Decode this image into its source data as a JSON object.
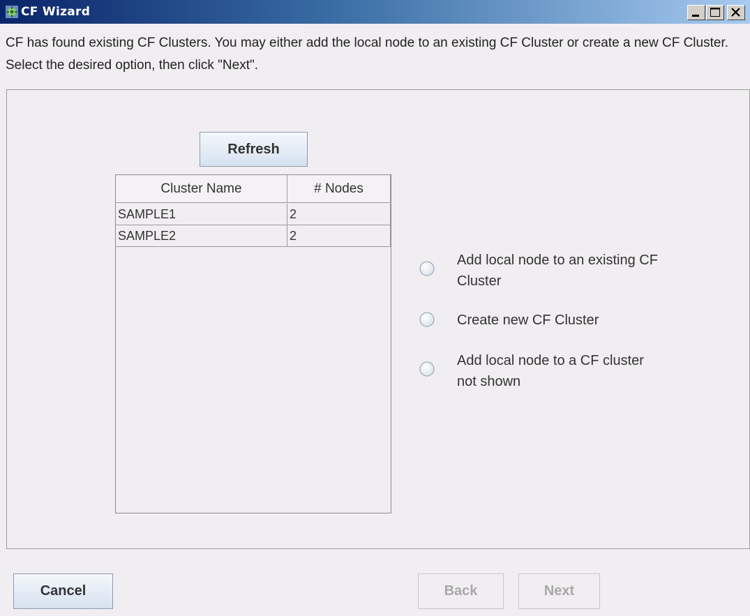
{
  "window": {
    "title": "CF Wizard",
    "icon": "cf-wizard-app-icon",
    "controls": [
      "minimize",
      "maximize",
      "close"
    ]
  },
  "instructions": "CF has found existing CF Clusters. You may either add the local node to an existing CF Cluster or create a new CF Cluster. Select the desired option, then click \"Next\".",
  "refresh_label": "Refresh",
  "table": {
    "columns": [
      "Cluster Name",
      "# Nodes"
    ],
    "rows": [
      [
        "SAMPLE1",
        "2"
      ],
      [
        "SAMPLE2",
        "2"
      ]
    ]
  },
  "options": [
    {
      "label": "Add local node to an existing CF Cluster",
      "selected": false
    },
    {
      "label": "Create new CF Cluster",
      "selected": false
    },
    {
      "label": "Add local node to a CF cluster not shown",
      "selected": false
    }
  ],
  "buttons": {
    "cancel": "Cancel",
    "back": "Back",
    "next": "Next"
  },
  "colors": {
    "titlebar_start": "#0a246a",
    "titlebar_end": "#a6caf0",
    "background": "#f1eef1",
    "disabled_text": "#a8a8a8"
  }
}
